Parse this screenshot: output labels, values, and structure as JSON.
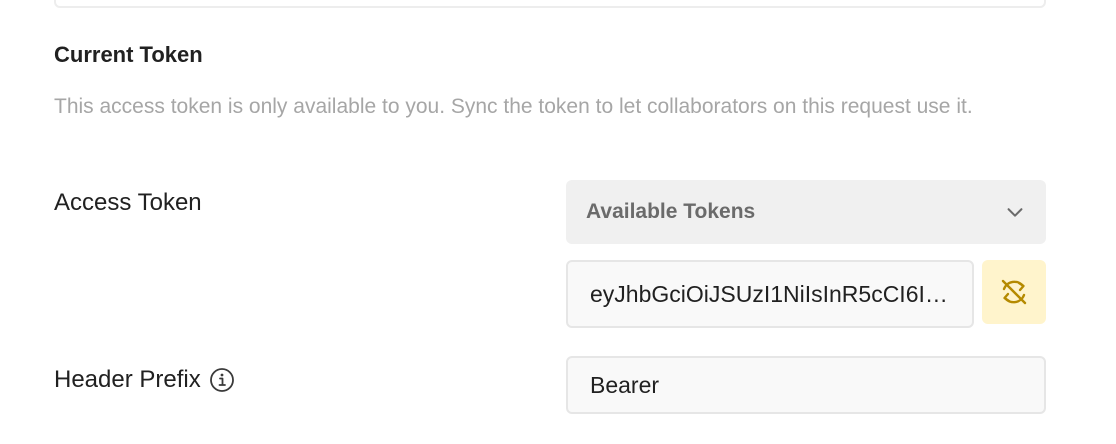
{
  "section": {
    "title": "Current Token",
    "description": "This access token is only available to you. Sync the token to let collaborators on this request use it."
  },
  "access_token": {
    "label": "Access Token",
    "dropdown_label": "Available Tokens",
    "value": "eyJhbGciOiJSUzI1NiIsInR5cCI6IkpXVCJ9",
    "sync_icon": "sync-off-icon"
  },
  "header_prefix": {
    "label": "Header Prefix",
    "info_icon": "info-icon",
    "value": "Bearer"
  },
  "colors": {
    "accent": "#b58a00",
    "sync_bg": "#fff4cc",
    "muted_text": "#a6a6a6"
  }
}
